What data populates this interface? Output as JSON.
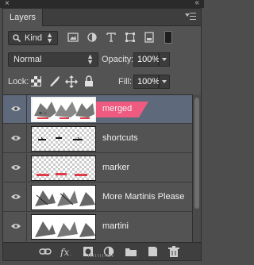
{
  "window": {
    "close_glyph": "×",
    "collapse_glyph": "«"
  },
  "panel": {
    "tab_label": "Layers",
    "menu_icon": "panel-menu-icon"
  },
  "filter": {
    "kind_label": "Kind",
    "icons": [
      "pixel-filter-icon",
      "adjustment-filter-icon",
      "type-filter-icon",
      "shape-filter-icon",
      "smart-object-filter-icon"
    ]
  },
  "blend": {
    "mode": "Normal",
    "opacity_label": "Opacity:",
    "opacity_value": "100%"
  },
  "lock": {
    "label": "Lock:",
    "fill_label": "Fill:",
    "fill_value": "100%"
  },
  "layers": [
    {
      "name": "merged",
      "selected": true,
      "thumb": "merged"
    },
    {
      "name": "shortcuts",
      "selected": false,
      "thumb": "shortcuts"
    },
    {
      "name": "marker",
      "selected": false,
      "thumb": "marker"
    },
    {
      "name": "More Martinis Please",
      "selected": false,
      "thumb": "martini"
    },
    {
      "name": "martini",
      "selected": false,
      "thumb": "martini"
    }
  ],
  "accent_colors": {
    "selected_row": "#5e6a7c",
    "marker_red": "#e03a4a",
    "pink_tag": "#ee5a80"
  }
}
